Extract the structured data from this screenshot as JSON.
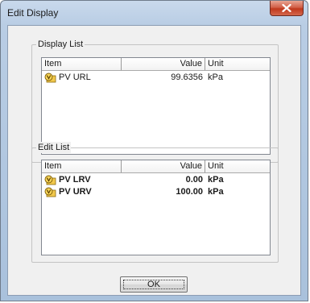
{
  "window": {
    "title": "Edit Display",
    "close_icon": "close-icon"
  },
  "display_list": {
    "title": "Display List",
    "columns": {
      "item": "Item",
      "value": "Value",
      "unit": "Unit"
    },
    "rows": [
      {
        "icon": "parameter-icon",
        "item": "PV URL",
        "value": "99.6356",
        "unit": "kPa"
      }
    ]
  },
  "edit_list": {
    "title": "Edit List",
    "columns": {
      "item": "Item",
      "value": "Value",
      "unit": "Unit"
    },
    "rows": [
      {
        "icon": "parameter-icon",
        "item": "PV LRV",
        "value": "0.00",
        "unit": "kPa"
      },
      {
        "icon": "parameter-icon",
        "item": "PV URV",
        "value": "100.00",
        "unit": "kPa"
      }
    ]
  },
  "buttons": {
    "ok_label": "OK"
  },
  "colors": {
    "close_button": "#c0381d",
    "title_bar": "#b9cde4",
    "dialog_background": "#f0f0f0"
  }
}
